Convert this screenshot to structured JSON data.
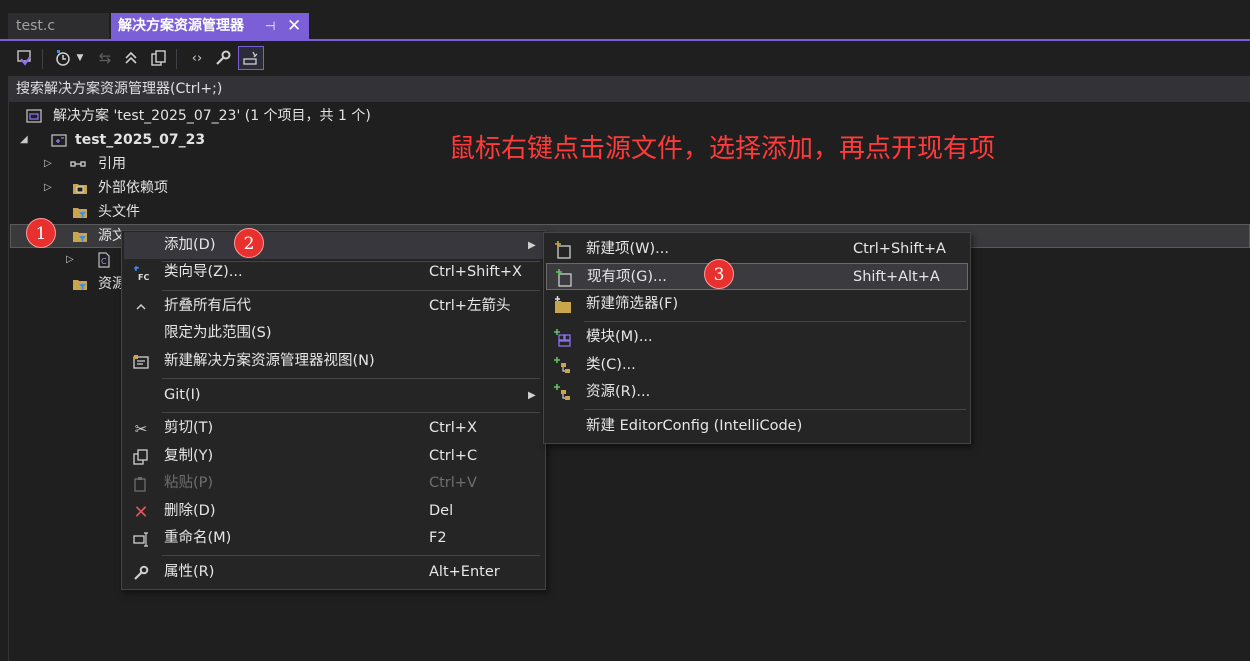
{
  "tabs": [
    {
      "label": "test.c",
      "active": false
    },
    {
      "label": "解决方案资源管理器",
      "active": true,
      "pin": "⊣",
      "close": "✕"
    }
  ],
  "toolbar": {
    "icons": [
      "vs-solution-icon",
      "history-icon",
      "dropdown-icon",
      "sync-icon",
      "collapse-all-icon",
      "show-all-files-icon",
      "view-code-icon",
      "properties-icon",
      "preview-icon"
    ]
  },
  "search": {
    "placeholder": "搜索解决方案资源管理器(Ctrl+;)"
  },
  "tree": {
    "solution": "解决方案 'test_2025_07_23' (1 个项目，共 1 个)",
    "project": "test_2025_07_23",
    "references": "引用",
    "external_deps": "外部依赖项",
    "header_files": "头文件",
    "source_files": "源文件",
    "resource_files": "资源文件"
  },
  "annotation": "鼠标右键点击源文件，选择添加，再点开现有项",
  "badges": [
    "1",
    "2",
    "3"
  ],
  "context_menu": [
    {
      "label": "添加(D)",
      "shortcut": "",
      "submenu": true
    },
    {
      "label": "类向导(Z)...",
      "shortcut": "Ctrl+Shift+X"
    },
    {
      "label": "折叠所有后代",
      "shortcut": "Ctrl+左箭头"
    },
    {
      "label": "限定为此范围(S)",
      "shortcut": ""
    },
    {
      "label": "新建解决方案资源管理器视图(N)",
      "shortcut": ""
    },
    {
      "label": "Git(I)",
      "shortcut": "",
      "submenu": true
    },
    {
      "label": "剪切(T)",
      "shortcut": "Ctrl+X"
    },
    {
      "label": "复制(Y)",
      "shortcut": "Ctrl+C"
    },
    {
      "label": "粘贴(P)",
      "shortcut": "Ctrl+V",
      "disabled": true
    },
    {
      "label": "删除(D)",
      "shortcut": "Del"
    },
    {
      "label": "重命名(M)",
      "shortcut": "F2"
    },
    {
      "label": "属性(R)",
      "shortcut": "Alt+Enter"
    }
  ],
  "add_submenu": [
    {
      "label": "新建项(W)...",
      "shortcut": "Ctrl+Shift+A"
    },
    {
      "label": "现有项(G)...",
      "shortcut": "Shift+Alt+A"
    },
    {
      "label": "新建筛选器(F)",
      "shortcut": ""
    },
    {
      "label": "模块(M)...",
      "shortcut": ""
    },
    {
      "label": "类(C)...",
      "shortcut": ""
    },
    {
      "label": "资源(R)...",
      "shortcut": ""
    },
    {
      "label": "新建 EditorConfig (IntelliCode)",
      "shortcut": ""
    }
  ],
  "colors": {
    "accent": "#7a5fd6",
    "annotation": "#ff3a3a",
    "badge": "#e8312e",
    "delete_icon": "#e05555"
  }
}
